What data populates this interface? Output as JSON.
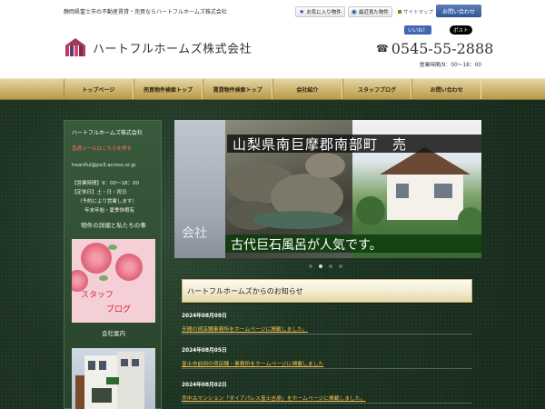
{
  "header": {
    "tagline": "静岡県富士市の不動産賃貸・売買ならハートフルホームズ株式会社",
    "favorites_label": "お気に入り物件",
    "recent_label": "最近見た物件",
    "sitemap_label": "サイトマップ",
    "contact_label": "お問い合わせ",
    "company_name": "ハートフルホームズ株式会社",
    "fb_like": "いいね！",
    "tw_post": "ポスト",
    "phone": "0545-55-2888",
    "hours": "営業時間/9：00～18：00"
  },
  "nav": {
    "items": [
      {
        "label": "トップページ"
      },
      {
        "label": "売買物件検索トップ"
      },
      {
        "label": "賃貸物件検索トップ"
      },
      {
        "label": "会社紹介"
      },
      {
        "label": "スタッフブログ"
      },
      {
        "label": "お問い合わせ"
      }
    ]
  },
  "sidebar": {
    "title": "ハートフルホームズ株式会社",
    "mail_text": "直通メールはこちらを押す",
    "email": "heartful@po3.across.or.jp",
    "hours": "【営業時間】9：00～18：00",
    "closed": "【定休日】土・日・祝日",
    "closed_note": "（予約により営業します）",
    "closed_note2": "年末年始・夏季休暇有",
    "details_heading": "物件の詳細と私たちの事",
    "staff_blog_line1": "スタッフ",
    "staff_blog_line2": "ブログ",
    "company_intro": "会社案内"
  },
  "slider": {
    "title": "山梨県南巨摩郡南部町　売",
    "caption": "古代巨石風呂が人気です。",
    "left_kanji": "会社",
    "active_index": 1,
    "count": 4
  },
  "news": {
    "heading": "ハートフルホームズからのお知らせ",
    "items": [
      {
        "date": "2024年08月09日",
        "text": "天間の貸店舗事務所をホームページに掲載しました。"
      },
      {
        "date": "2024年08月05日",
        "text": "富士市前田の貸店舗・事務所をホームページに掲載しました"
      },
      {
        "date": "2024年08月02日",
        "text": "売中古マンション「ダイアパレス富士吉原」をホームページに掲載しました。"
      }
    ]
  },
  "colors": {
    "nav_gold": "#cdb46f",
    "background_green": "#1d3322",
    "link_gold": "#f5c451",
    "contact_blue": "#2e5596"
  }
}
